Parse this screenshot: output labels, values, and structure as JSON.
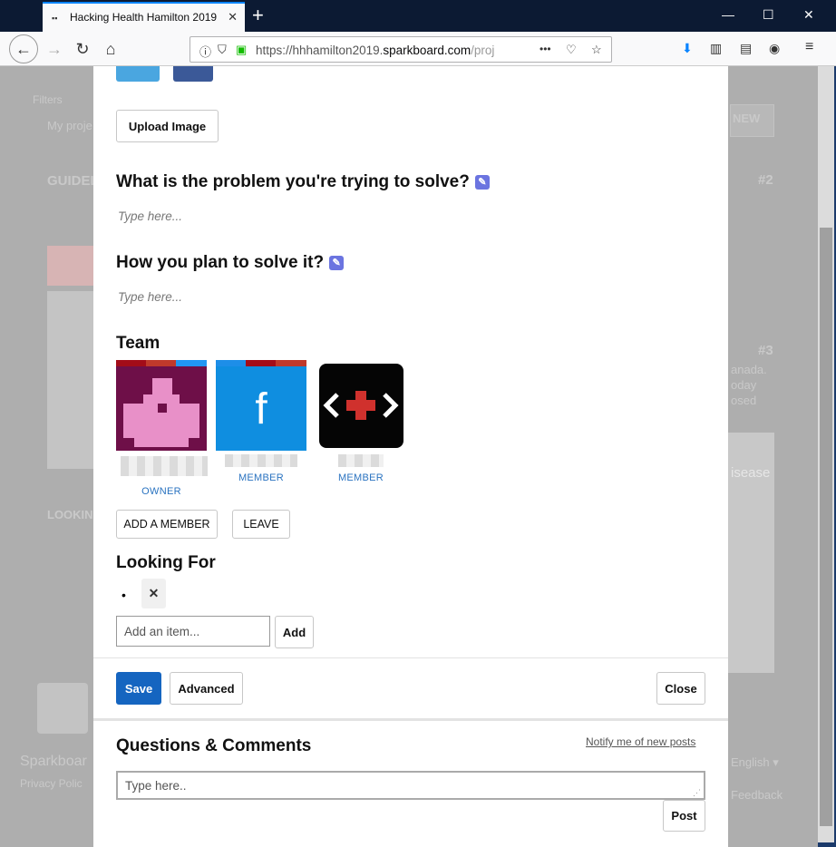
{
  "browser": {
    "tab_title": "Hacking Health Hamilton 2019",
    "url_prefix": "https://hhhamilton2019.",
    "url_domain": "sparkboard.com",
    "url_suffix": "/proj",
    "newtab_glyph": "+",
    "menu_dots": "•••"
  },
  "background": {
    "filters": "Filters",
    "my_projects": "My proje",
    "guide": "GUIDEL",
    "new_btn": "NEW",
    "rank2": "#2",
    "rank3": "#3",
    "looking": "LOOKIN",
    "sparkboard": "Sparkboar",
    "privacy": "Privacy Polic",
    "english": "English ▾",
    "feedback": "Feedback",
    "canada": "anada.",
    "today": "oday",
    "osed": "osed",
    "disease": "isease"
  },
  "modal": {
    "upload_image_label": "Upload Image",
    "problem_heading": "What is the problem you're trying to solve?",
    "problem_placeholder": "Type here...",
    "plan_heading": "How you plan to solve it?",
    "plan_placeholder": "Type here...",
    "team_heading": "Team",
    "members": [
      {
        "role": "OWNER"
      },
      {
        "role": "MEMBER"
      },
      {
        "role": "MEMBER"
      }
    ],
    "add_member_label": "ADD A MEMBER",
    "leave_label": "LEAVE",
    "looking_for_heading": "Looking For",
    "add_item_placeholder": "Add an item...",
    "add_label": "Add",
    "save_label": "Save",
    "advanced_label": "Advanced",
    "close_label": "Close"
  },
  "comments": {
    "heading": "Questions & Comments",
    "notify_link": "Notify me of new posts",
    "input_placeholder": "Type here..",
    "post_label": "Post"
  },
  "colors": {
    "accent": "#1565c0",
    "edit_icon": "#6b74e0",
    "role_text": "#2a73c0"
  }
}
